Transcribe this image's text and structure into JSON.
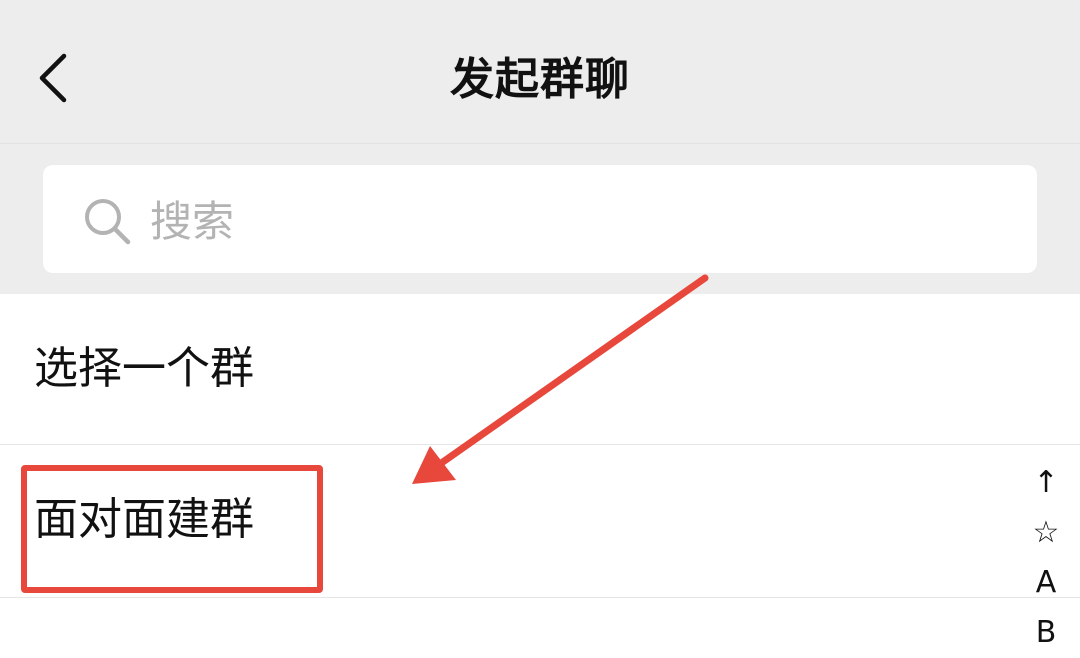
{
  "header": {
    "title": "发起群聊",
    "back_icon": "chevron-left-icon"
  },
  "search": {
    "placeholder": "搜索",
    "value": "",
    "icon": "search-icon"
  },
  "list": {
    "items": [
      {
        "label": "选择一个群"
      },
      {
        "label": "面对面建群"
      }
    ]
  },
  "index_bar": {
    "letters": [
      "↑",
      "☆",
      "A",
      "B"
    ]
  },
  "colors": {
    "nav_background": "#ededed",
    "annotation_red": "#e8473c",
    "placeholder_gray": "#b3b3b3"
  }
}
